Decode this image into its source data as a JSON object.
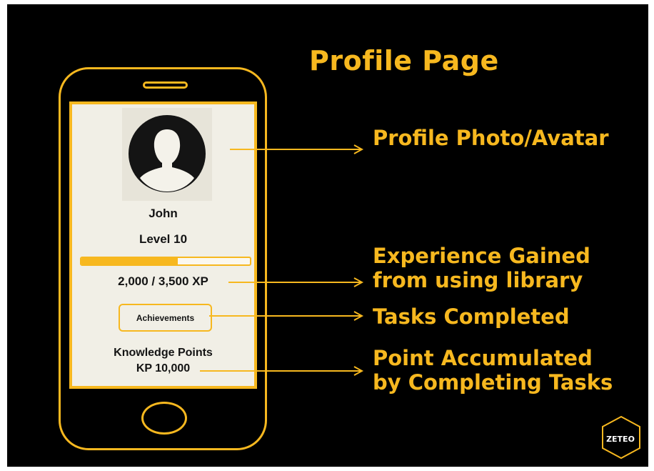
{
  "title": "Profile Page",
  "phone": {
    "user_name": "John",
    "level": "Level 10",
    "xp_progress": 0.57,
    "xp_text": "2,000 / 3,500 XP",
    "achievements_label": "Achievements",
    "kp_label": "Knowledge Points",
    "kp_value": "KP 10,000"
  },
  "annotations": [
    "Profile Photo/Avatar",
    "Experience Gained\nfrom using library",
    "Tasks Completed",
    "Point Accumulated\nby Completing Tasks"
  ],
  "logo_text": "ZETEO",
  "colors": {
    "accent": "#f7b81f",
    "background": "#000000",
    "screen": "#f1efe6",
    "text_dark": "#141414"
  }
}
